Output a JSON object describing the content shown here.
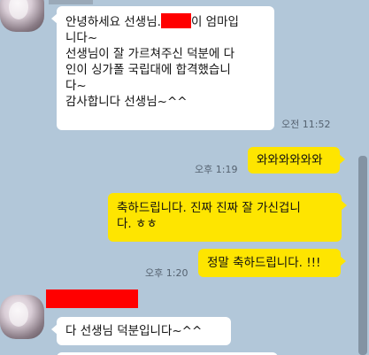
{
  "messages": [
    {
      "id": "m1",
      "direction": "in",
      "lines": [
        "안녕하세요 선생님.",
        "이 엄마입",
        "니다~",
        "선생님이 잘 가르쳐주신 덕분에 다",
        "인이 싱가폴 국립대에 합격했습니",
        "다~",
        "감사합니다 선생님~^^"
      ],
      "time": "오전 11:52"
    },
    {
      "id": "m2",
      "direction": "out",
      "text": "와와와와와와",
      "time": "오후 1:19"
    },
    {
      "id": "m3",
      "direction": "out",
      "lines": [
        "축하드립니다. 진짜 진짜 잘 가신겁니",
        "다. ㅎㅎ"
      ]
    },
    {
      "id": "m4",
      "direction": "out",
      "text": "정말 축하드립니다. !!!",
      "time": "오후 1:20"
    },
    {
      "id": "m5",
      "direction": "in",
      "text": "다 선생님 덕분입니다~^^"
    }
  ],
  "colors": {
    "background": "#b2c7d9",
    "outgoing_bubble": "#fee500",
    "incoming_bubble": "#ffffff",
    "redaction": "#ff0000"
  }
}
